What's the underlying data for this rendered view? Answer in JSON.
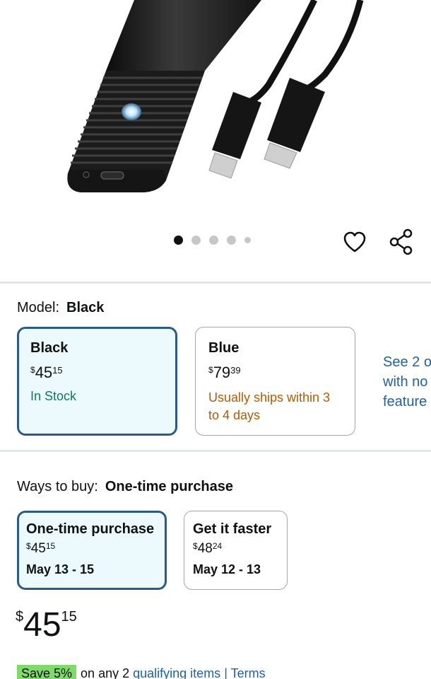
{
  "gallery": {
    "dots_total": 5,
    "active_index": 0
  },
  "actions": {
    "like_icon": "heart-icon",
    "share_icon": "share-icon"
  },
  "model": {
    "label": "Model:",
    "selected": "Black",
    "options": [
      {
        "name": "Black",
        "price_whole": "45",
        "price_cents": "15",
        "currency": "$",
        "availability": "In Stock",
        "selected": true
      },
      {
        "name": "Blue",
        "price_whole": "79",
        "price_cents": "39",
        "currency": "$",
        "availability": "Usually ships within 3 to 4 days",
        "selected": false
      }
    ],
    "see_more": [
      "See 2 o",
      "with no",
      "feature"
    ]
  },
  "ways_to_buy": {
    "label": "Ways to buy:",
    "selected": "One-time purchase",
    "options": [
      {
        "title": "One-time purchase",
        "currency": "$",
        "price_whole": "45",
        "price_cents": "15",
        "date": "May 13 - 15",
        "selected": true
      },
      {
        "title": "Get it faster",
        "currency": "$",
        "price_whole": "48",
        "price_cents": "24",
        "date": "May 12 - 13",
        "selected": false
      }
    ]
  },
  "price": {
    "currency": "$",
    "whole": "45",
    "cents": "15"
  },
  "promo": {
    "badge": "Save 5%",
    "text": "on any 2",
    "link": "qualifying items",
    "separator": "|",
    "terms": "Terms"
  },
  "colors": {
    "selected_border": "#2b5a86",
    "selected_bg": "#edfafd",
    "in_stock": "#067d62",
    "ships_later": "#b35c00",
    "link": "#2162a1",
    "promo_badge": "#7fda69"
  }
}
